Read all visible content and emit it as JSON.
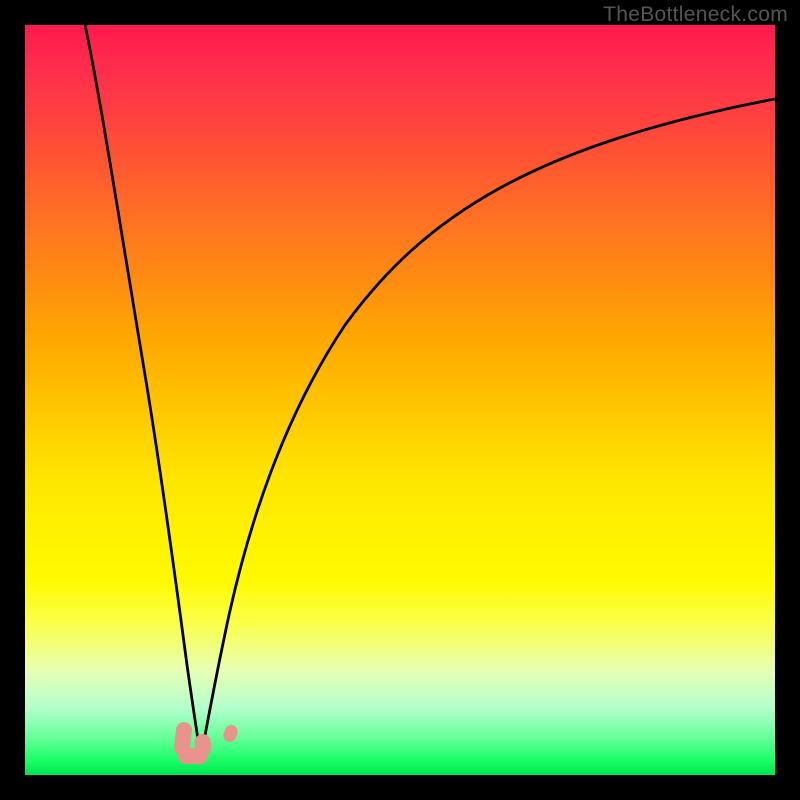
{
  "watermark": "TheBottleneck.com",
  "chart_data": {
    "type": "line",
    "title": "",
    "xlabel": "",
    "ylabel": "",
    "x_range": [
      0,
      100
    ],
    "y_range": [
      0,
      100
    ],
    "series": [
      {
        "name": "bottleneck-curve",
        "description": "V-shaped performance curve (inferred percentage bottleneck). Descends steeply from top-left, reaches minimum near x≈23, then rises asymptotically toward the right.",
        "x": [
          0.5,
          3,
          6,
          9,
          12,
          15,
          18,
          20,
          21.5,
          23,
          24.5,
          26,
          29,
          34,
          40,
          48,
          58,
          70,
          84,
          100
        ],
        "y": [
          100,
          87,
          73,
          60,
          47,
          34,
          20,
          10,
          4,
          0.5,
          4,
          11,
          25,
          42,
          55,
          66,
          74.5,
          81,
          86.5,
          91
        ]
      }
    ],
    "markers": [
      {
        "name": "optimal-marker-L",
        "shape": "L",
        "x": 21.5,
        "y": 2,
        "color": "#e8938c"
      },
      {
        "name": "optimal-marker-dot",
        "shape": "dot",
        "x": 26.1,
        "y": 5,
        "color": "#e8938c"
      }
    ],
    "gradient_stops": [
      {
        "pos": 0,
        "color": "#ff1a4d"
      },
      {
        "pos": 50,
        "color": "#ffd000"
      },
      {
        "pos": 80,
        "color": "#faff4d"
      },
      {
        "pos": 100,
        "color": "#00e650"
      }
    ]
  }
}
